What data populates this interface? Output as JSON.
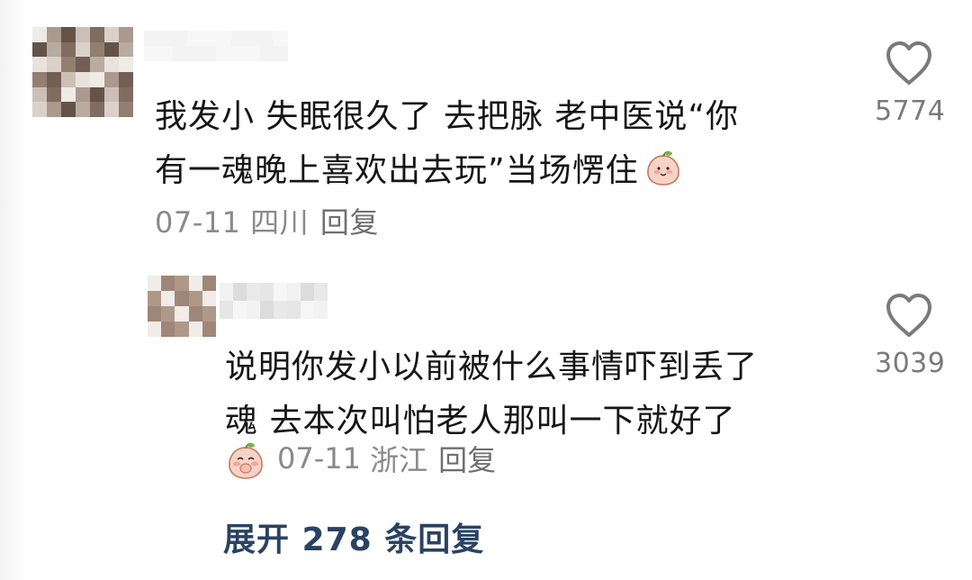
{
  "comment": {
    "text_line1": "我发小 失眠很久了 去把脉 老中医说“你",
    "text_line2": "有一魂晚上喜欢出去玩”当场愣住",
    "emoji": "peach-emoji-icon",
    "date": "07-11",
    "location": "四川",
    "reply_label": "回复",
    "likes": "5774"
  },
  "reply": {
    "text_line1": "说明你发小以前被什么事情吓到丢了",
    "text_line2": "魂 去本次叫怕老人那叫一下就好了",
    "emoji": "peach-shy-emoji-icon",
    "date": "07-11",
    "location": "浙江",
    "reply_label": "回复",
    "likes": "3039"
  },
  "expand_label": "展开 278 条回复",
  "colors": {
    "text": "#161616",
    "meta": "#8a8a8a",
    "expand": "#2a4263",
    "heart": "#7a7a7a"
  }
}
